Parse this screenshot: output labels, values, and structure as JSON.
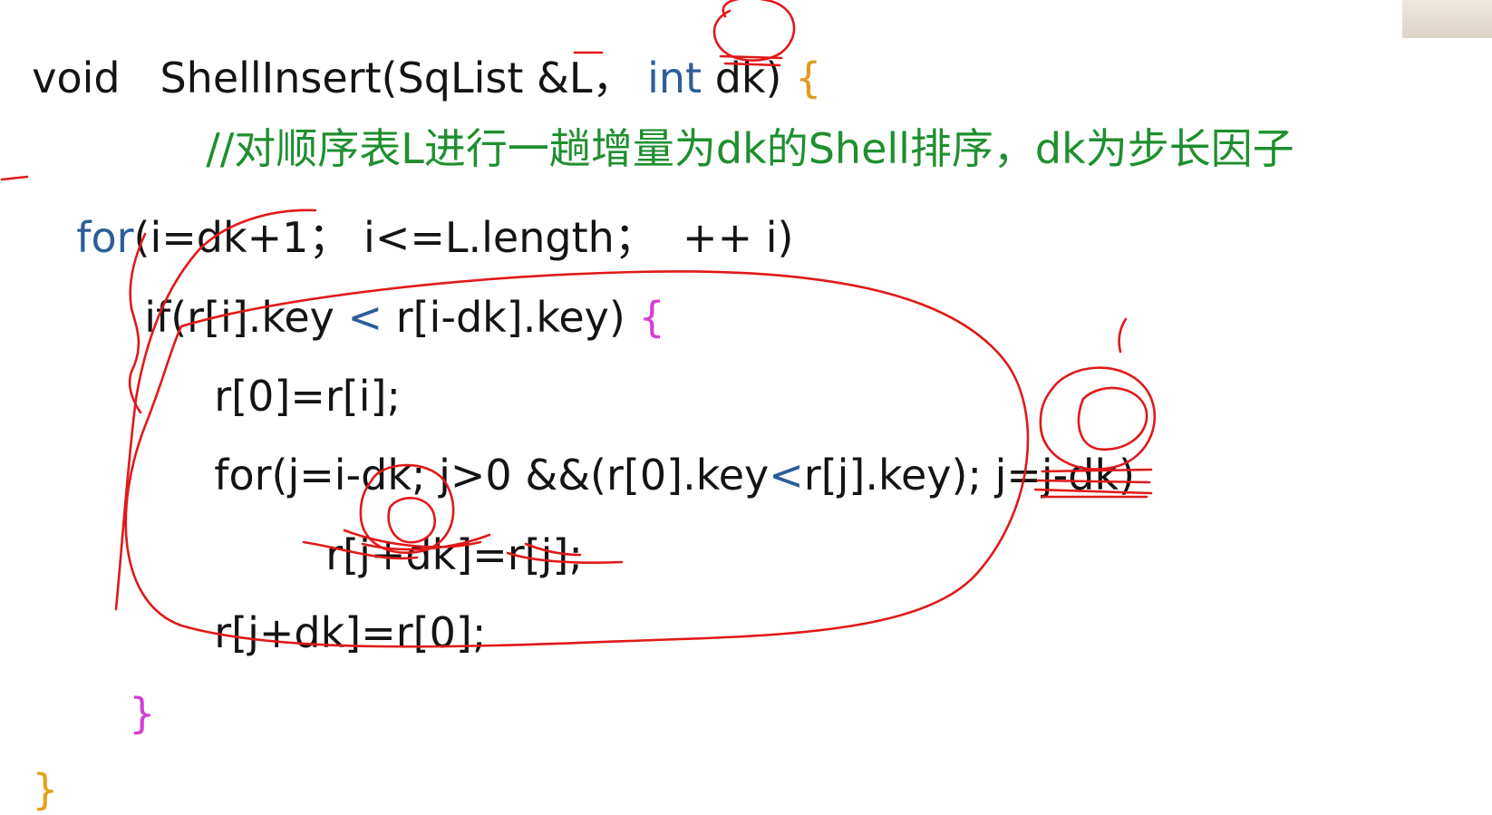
{
  "code": {
    "line1": {
      "part1": "void   ShellInsert(SqList &L， ",
      "kw": "int",
      "part2": " dk) ",
      "brace": "{"
    },
    "comment": "//对顺序表L进行一趟增量为dk的Shell排序，dk为步长因子",
    "line3": {
      "kw": "for",
      "rest": "(i=dk+1； i<=L.length；  ++ i)"
    },
    "line4": {
      "text": "if(r[i].key ",
      "lt": "<",
      "text2": " r[i-dk].key) ",
      "brace": "{"
    },
    "line5": "r[0]=r[i];",
    "line6": {
      "text": "for(j=i-dk; j>0 &&(r[0].key",
      "lt": "<",
      "text2": "r[j].key); j=j-dk)"
    },
    "line7": "r[j+dk]=r[j];",
    "line8": "r[j+dk]=r[0];",
    "line9": "}",
    "line10": "}"
  },
  "colors": {
    "keyword": "#2c5d9a",
    "comment": "#1f8f2f",
    "ink": "#e0191a",
    "brace_orange": "#e09a1f",
    "brace_magenta": "#d43fd3"
  }
}
